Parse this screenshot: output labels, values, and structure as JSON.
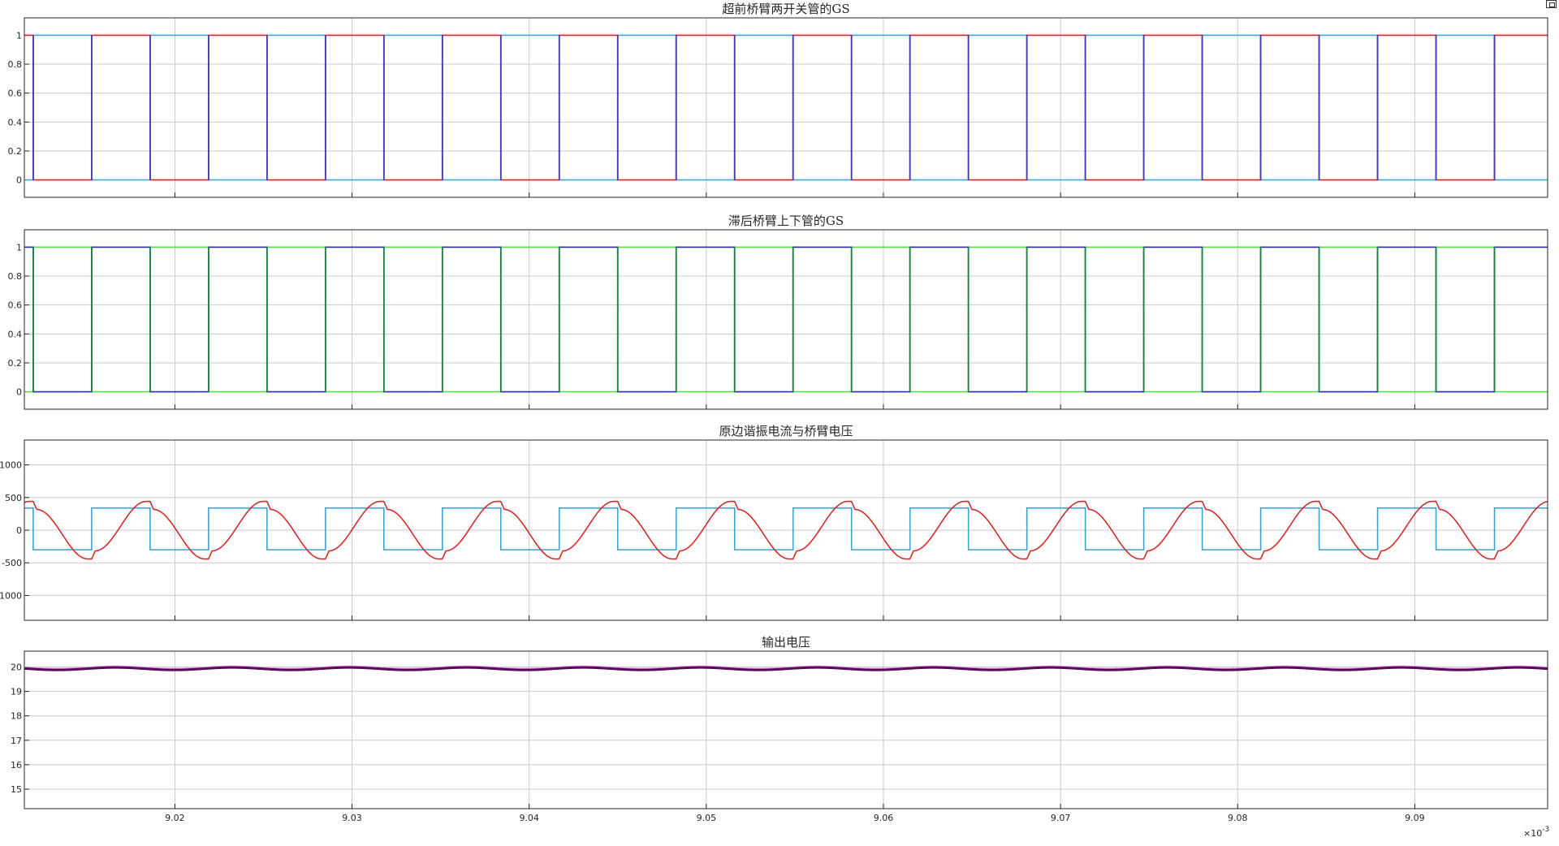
{
  "chart_data": [
    {
      "type": "line",
      "title": "超前桥臂两开关管的GS",
      "xlim": [
        9.0115,
        9.0975
      ],
      "ylim": [
        -0.12,
        1.12
      ],
      "yticks": [
        0,
        0.2,
        0.4,
        0.6,
        0.8,
        1
      ],
      "ytick_labels": [
        "0",
        "0.2",
        "0.4",
        "0.6",
        "0.8",
        "1"
      ],
      "grid": true,
      "signal": {
        "kind": "complementary_square",
        "period": 0.0066,
        "first_rise_a": 0.0153,
        "on_time": 0.0033,
        "first_rise_b": 0.012,
        "low": 0,
        "high": 1
      },
      "series": [
        {
          "color": "#d7262b",
          "overlay_color": "#3b3bb8"
        },
        {
          "color": "#3fa9d8"
        }
      ]
    },
    {
      "type": "line",
      "title": "滞后桥臂上下管的GS",
      "xlim": [
        9.0115,
        9.0975
      ],
      "ylim": [
        -0.12,
        1.12
      ],
      "yticks": [
        0,
        0.2,
        0.4,
        0.6,
        0.8,
        1
      ],
      "ytick_labels": [
        "0",
        "0.2",
        "0.4",
        "0.6",
        "0.8",
        "1"
      ],
      "grid": true,
      "signal": {
        "kind": "complementary_square",
        "period": 0.0066,
        "first_rise_a": 0.0153,
        "on_time": 0.0033,
        "first_rise_b": 0.012,
        "low": 0,
        "high": 1
      },
      "series": [
        {
          "color": "#2b2bb0",
          "overlay_color": "#1f7f3a"
        },
        {
          "color": "#52e04a"
        }
      ]
    },
    {
      "type": "line",
      "title": "原边谐振电流与桥臂电压",
      "xlim": [
        9.0115,
        9.0975
      ],
      "ylim": [
        -1380,
        1380
      ],
      "yticks": [
        -1000,
        -500,
        0,
        500,
        1000
      ],
      "ytick_labels": [
        "-1000",
        "-500",
        "0",
        "500",
        "1000"
      ],
      "grid": true,
      "signal": {
        "kind": "bridge",
        "period": 0.0066,
        "voltage_high": 340,
        "voltage_low": -300,
        "voltage_rise": 0.0153,
        "voltage_fall": 0.0186,
        "current_peak": 440
      },
      "series": [
        {
          "color": "#3fa0d8"
        },
        {
          "color": "#d42a2a"
        }
      ]
    },
    {
      "type": "line",
      "title": "输出电压",
      "xlim": [
        9.0115,
        9.0975
      ],
      "ylim": [
        14.2,
        20.65
      ],
      "yticks": [
        15,
        16,
        17,
        18,
        19,
        20
      ],
      "ytick_labels": [
        "15",
        "16",
        "17",
        "18",
        "19",
        "20"
      ],
      "xticks": [
        9.02,
        9.03,
        9.04,
        9.05,
        9.06,
        9.07,
        9.08,
        9.09
      ],
      "xtick_labels": [
        "9.02",
        "9.03",
        "9.04",
        "9.05",
        "9.06",
        "9.07",
        "9.08",
        "9.09"
      ],
      "x_exponent_base": "×10",
      "x_exponent_power": "-3",
      "grid": true,
      "signal": {
        "kind": "ripple",
        "period": 0.0066,
        "mean": 19.93,
        "amplitude": 0.05
      },
      "series": [
        {
          "color": "#5a0a5a"
        },
        {
          "color": "#e39be8",
          "offset": 0.06
        }
      ]
    }
  ]
}
